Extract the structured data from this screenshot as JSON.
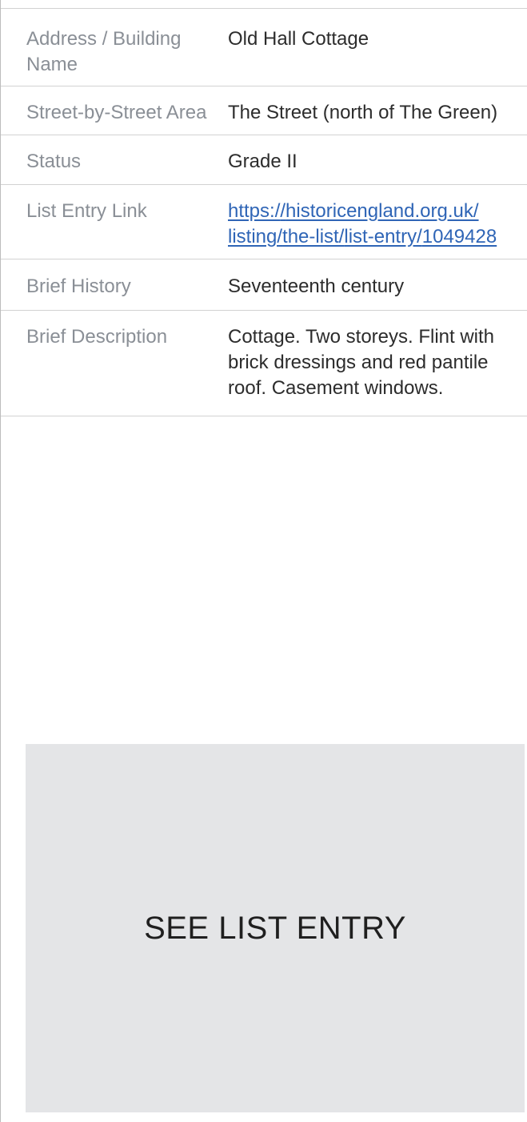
{
  "details": {
    "address_label": "Address / Building Name",
    "address_value": "Old Hall Cottage",
    "area_label": "Street-by-Street Area",
    "area_value": "The Street (north of The Green)",
    "status_label": "Status",
    "status_value": "Grade II",
    "link_label": "List Entry Link",
    "link_value": "https://historicengland.org.uk/listing/the-list/list-entry/1049428",
    "history_label": "Brief History",
    "history_value": "Seventeenth century",
    "description_label": "Brief Description",
    "description_value": "Cottage. Two storeys. Flint with brick dressings and red pantile roof. Casement windows."
  },
  "button": {
    "label": "SEE LIST ENTRY"
  },
  "colors": {
    "label_text": "#8a8f96",
    "value_text": "#2c2c2c",
    "link": "#2f65b6",
    "button_bg": "#e4e5e7"
  }
}
